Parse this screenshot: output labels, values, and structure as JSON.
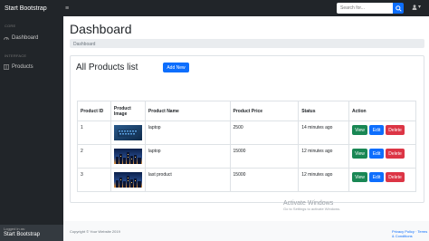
{
  "topbar": {
    "brand": "Start Bootstrap",
    "search_placeholder": "Search for...",
    "user_caret": "▾"
  },
  "sidebar": {
    "core_heading": "CORE",
    "dashboard_label": "Dashboard",
    "interface_heading": "INTERFACE",
    "products_label": "Products",
    "footer_small": "Logged in as:",
    "footer_user": "Start Bootstrap"
  },
  "main": {
    "title": "Dashboard",
    "breadcrumb": "Dashboard",
    "card_title": "All Products list",
    "add_button": "Add New",
    "columns": [
      "Product ID",
      "Product Image",
      "Product Name",
      "Product Price",
      "Status",
      "Action"
    ],
    "rows": [
      {
        "id": "1",
        "name": "laptop",
        "price": "2500",
        "status": "14 minutes ago",
        "image": "keyboard-photo"
      },
      {
        "id": "2",
        "name": "laptop",
        "price": "15000",
        "status": "12 minutes ago",
        "image": "city-night-photo"
      },
      {
        "id": "3",
        "name": "last product",
        "price": "15000",
        "status": "12 minutes ago",
        "image": "city-night-photo"
      }
    ],
    "view_label": "View",
    "edit_label": "Edit",
    "delete_label": "Delete"
  },
  "footer": {
    "copyright": "Copyright © Your Website 2019",
    "links": "Privacy Policy · Terms & Conditions"
  },
  "watermark": {
    "title": "Activate Windows",
    "subtitle": "Go to Settings to activate Windows."
  },
  "colors": {
    "dark": "#212529",
    "primary": "#0d6efd",
    "success": "#198754",
    "danger": "#dc3545"
  }
}
